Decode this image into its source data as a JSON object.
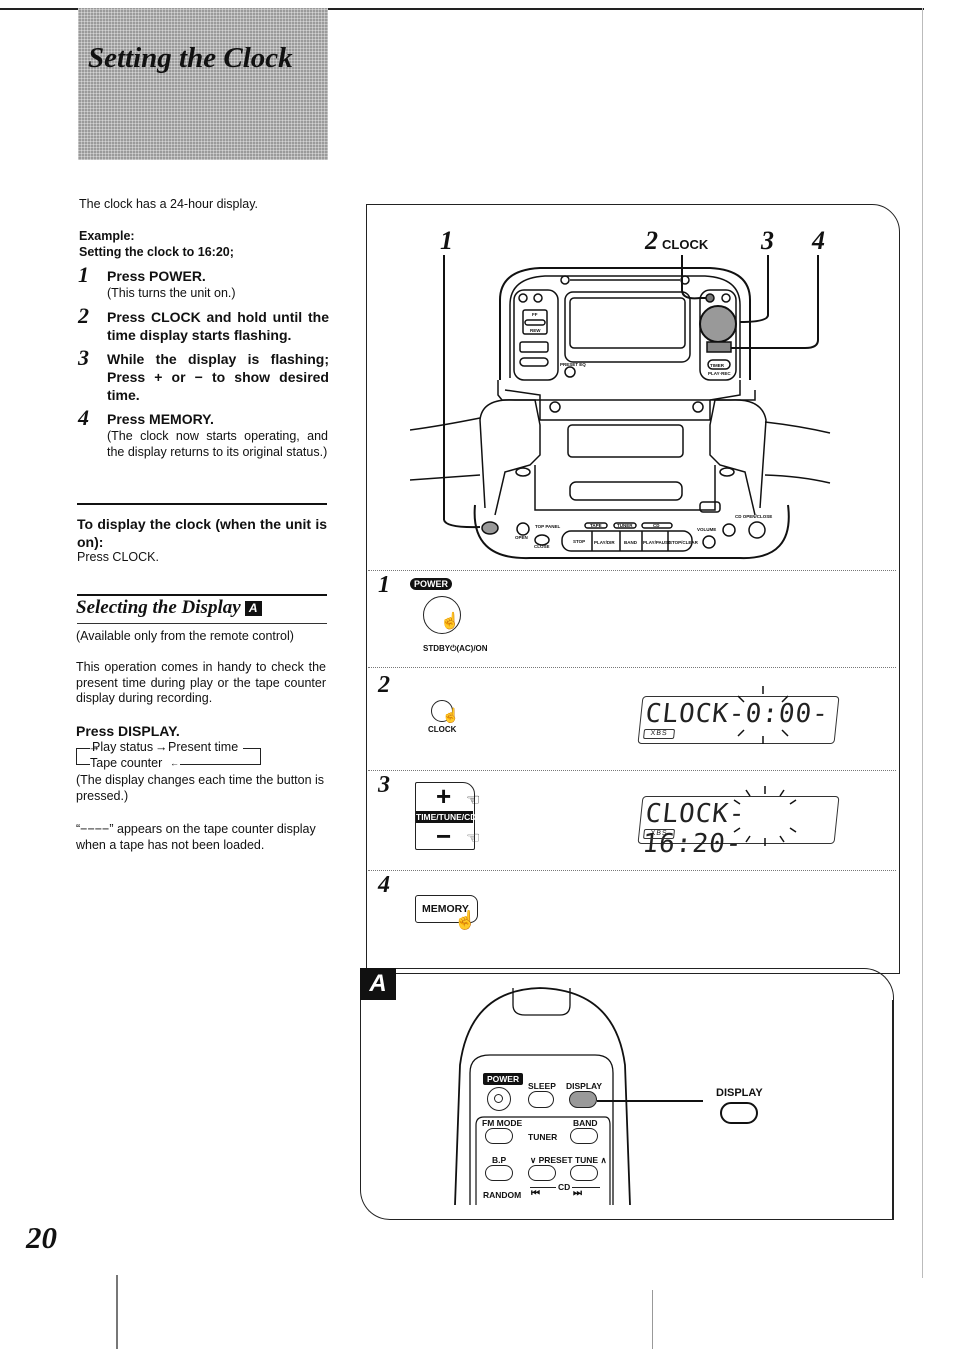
{
  "page": {
    "title": "Setting the Clock",
    "page_number": "20"
  },
  "left": {
    "intro": "The clock has a 24-hour display.",
    "example_label": "Example:",
    "example_text": "Setting the clock to 16:20;",
    "steps": [
      {
        "num": "1",
        "head": "Press POWER.",
        "sub": "(This turns the unit on.)"
      },
      {
        "num": "2",
        "head": "Press CLOCK and hold until the time display starts flashing.",
        "sub": ""
      },
      {
        "num": "3",
        "head": "While the display is flashing; Press + or − to show desired time.",
        "sub": ""
      },
      {
        "num": "4",
        "head": "Press MEMORY.",
        "sub": "(The clock now starts operating, and the display returns to its original status.)"
      }
    ],
    "display_clock": {
      "heading": "To display the clock (when the unit is on):",
      "body": "Press CLOCK."
    },
    "selecting_display": {
      "title": "Selecting the Display",
      "badge": "A",
      "note": "(Available only from the remote control)",
      "body": "This operation comes in handy to check the present time during play or the tape counter display during recording.",
      "press_heading": "Press DISPLAY.",
      "cycle": {
        "item1": "Play status",
        "item2": "Present time",
        "item3": "Tape counter"
      },
      "cycle_note": "(The display changes each time the button is pressed.)",
      "tape_note": "“−−−−” appears on the tape counter display when a tape has not been loaded."
    }
  },
  "diagram": {
    "callouts": {
      "c1": "1",
      "c2": "2",
      "c2_label": "CLOCK",
      "c3": "3",
      "c4": "4"
    },
    "unit_labels": {
      "stop": "STOP",
      "play": "PLAY/DIR",
      "band": "BAND",
      "playpause": "PLAY/PAUSE",
      "stopclear": "STOP/CLEAR",
      "tape": "TAPE",
      "tuner": "TUNER",
      "cd": "CD",
      "volume": "VOLUME",
      "top_panel": "TOP PANEL",
      "open": "OPEN",
      "close": "CLOSE",
      "cd_open": "CD OPEN/CLOSE",
      "timer": "TIMER",
      "play_rec": "PLAY·REC",
      "preset_ec": "PRESET EQ",
      "ff": "FF",
      "rew": "REW"
    },
    "steps": [
      {
        "num": "1",
        "power_label": "POWER",
        "button_label": "STDBY⏻(AC)/ON"
      },
      {
        "num": "2",
        "button_label": "CLOCK",
        "lcd": "CLOCK-0:00-",
        "lcd_badge": "XBS"
      },
      {
        "num": "3",
        "plus": "+",
        "minus": "−",
        "button_label": "TIME/TUNE/CD",
        "lcd": "CLOCK-16:20-",
        "lcd_badge": "XBS"
      },
      {
        "num": "4",
        "button_label": "MEMORY"
      }
    ]
  },
  "remote": {
    "tag": "A",
    "power": "POWER",
    "sleep": "SLEEP",
    "display": "DISPLAY",
    "fm_mode": "FM MODE",
    "tuner": "TUNER",
    "band": "BAND",
    "bp": "B.P",
    "preset_tune": "∨ PRESET TUNE ∧",
    "cd": "CD",
    "random": "RANDOM",
    "prev": "⏮",
    "next": "⏭",
    "callout": "DISPLAY"
  }
}
